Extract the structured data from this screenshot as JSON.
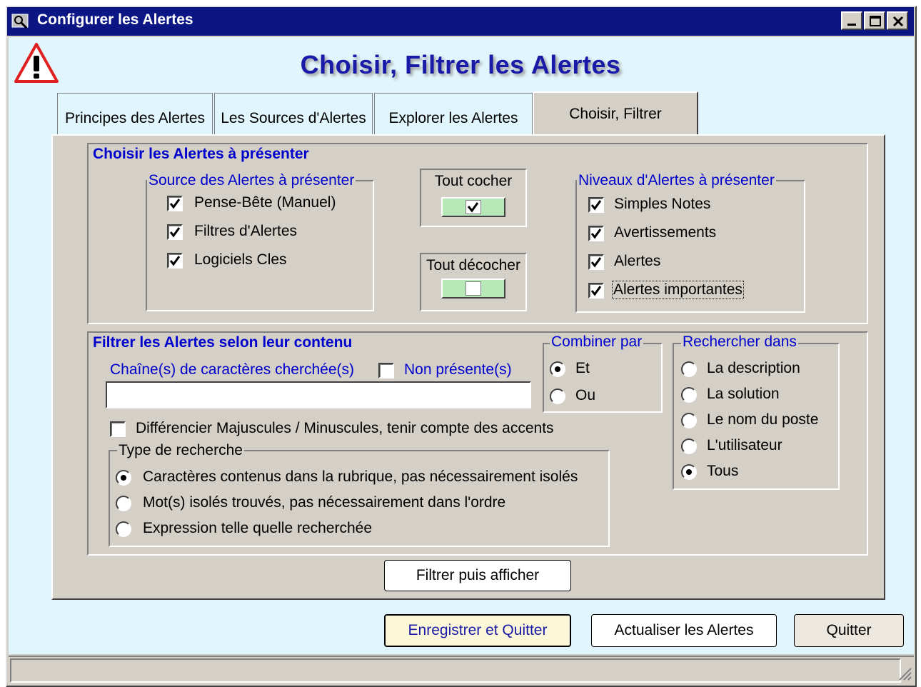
{
  "window": {
    "title": "Configurer les Alertes"
  },
  "heading": "Choisir, Filtrer les Alertes",
  "tabs": [
    {
      "label": "Principes des Alertes",
      "active": false
    },
    {
      "label": "Les Sources d'Alertes",
      "active": false
    },
    {
      "label": "Explorer les Alertes",
      "active": false
    },
    {
      "label": "Choisir, Filtrer",
      "active": true
    }
  ],
  "choose": {
    "title": "Choisir les Alertes à présenter",
    "sources": {
      "legend": "Source des Alertes à présenter",
      "items": [
        {
          "label": "Pense-Bête (Manuel)",
          "checked": true
        },
        {
          "label": "Filtres d'Alertes",
          "checked": true
        },
        {
          "label": "Logiciels Cles",
          "checked": true
        }
      ]
    },
    "check_all": {
      "label": "Tout cocher"
    },
    "uncheck_all": {
      "label": "Tout décocher"
    },
    "levels": {
      "legend": "Niveaux d'Alertes à présenter",
      "items": [
        {
          "label": "Simples Notes",
          "checked": true
        },
        {
          "label": "Avertissements",
          "checked": true
        },
        {
          "label": "Alertes",
          "checked": true
        },
        {
          "label": "Alertes importantes",
          "checked": true
        }
      ]
    }
  },
  "filter": {
    "title": "Filtrer les Alertes selon leur contenu",
    "search_label": "Chaîne(s) de caractères cherchée(s)",
    "not_present": {
      "label": "Non présente(s)",
      "checked": false
    },
    "search_value": "",
    "case_sensitive": {
      "label": "Différencier Majuscules / Minuscules, tenir compte des accents",
      "checked": false
    },
    "search_type": {
      "legend": "Type de recherche",
      "options": [
        {
          "label": "Caractères contenus dans la rubrique, pas nécessairement isolés",
          "selected": true
        },
        {
          "label": "Mot(s) isolés trouvés, pas nécessairement dans l'ordre",
          "selected": false
        },
        {
          "label": "Expression telle quelle recherchée",
          "selected": false
        }
      ]
    },
    "combine": {
      "legend": "Combiner par",
      "options": [
        {
          "label": "Et",
          "selected": true
        },
        {
          "label": "Ou",
          "selected": false
        }
      ]
    },
    "search_in": {
      "legend": "Rechercher dans",
      "options": [
        {
          "label": "La description",
          "selected": false
        },
        {
          "label": "La solution",
          "selected": false
        },
        {
          "label": "Le nom du poste",
          "selected": false
        },
        {
          "label": "L'utilisateur",
          "selected": false
        },
        {
          "label": "Tous",
          "selected": true
        }
      ]
    },
    "apply_button": "Filtrer puis afficher"
  },
  "footer": {
    "save_quit": "Enregistrer et Quitter",
    "refresh": "Actualiser les Alertes",
    "quit": "Quitter"
  },
  "colors": {
    "titlebar": "#0b1584",
    "client_bg": "#e1f6fc",
    "heading": "#1a1aa8",
    "section_title": "#0000cc"
  }
}
